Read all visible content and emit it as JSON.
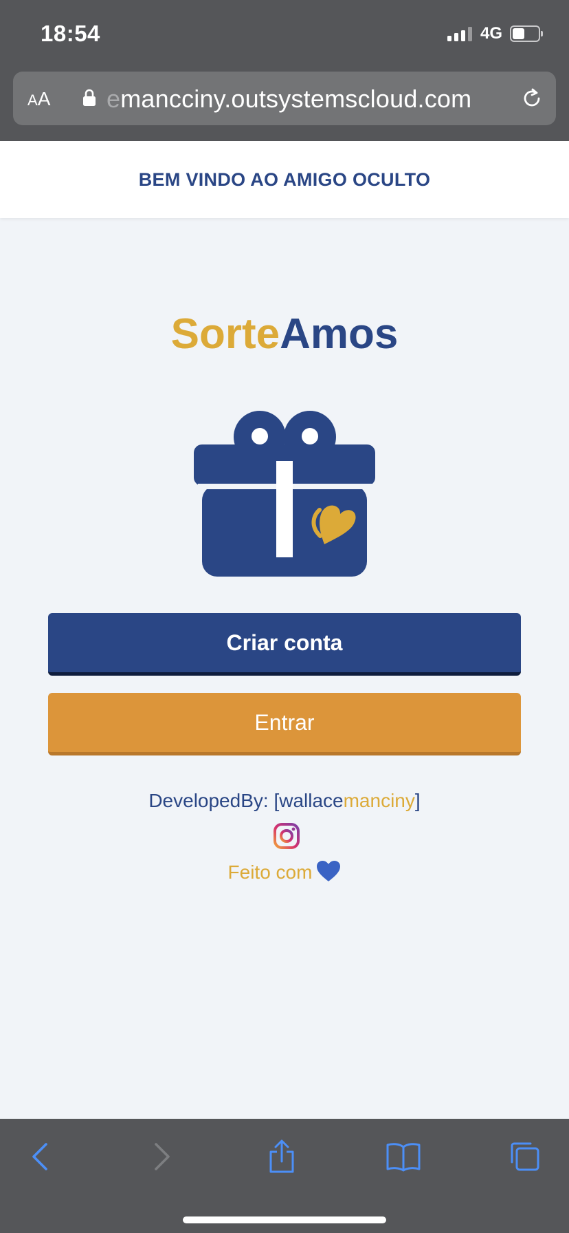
{
  "status_bar": {
    "time": "18:54",
    "network": "4G",
    "battery_level": 0.5
  },
  "browser": {
    "text_size_label_small": "A",
    "text_size_label_large": "A",
    "url_faded": "e",
    "url_main": "mancciny.outsystemscloud.com"
  },
  "header": {
    "title": "BEM VINDO AO AMIGO OCULTO"
  },
  "brand": {
    "part1": "Sorte",
    "part2": "Amos"
  },
  "buttons": {
    "create_account": "Criar conta",
    "login": "Entrar"
  },
  "footer": {
    "developed_by_prefix": "DevelopedBy: [wallace",
    "developed_by_highlight": "manciny",
    "developed_by_suffix": "]",
    "made_with": "Feito com"
  },
  "icons": {
    "gift": "gift-heart-logo",
    "instagram": "instagram-icon",
    "heart": "heart-icon"
  },
  "colors": {
    "primary_blue": "#2a4685",
    "gold": "#dcaa38",
    "orange_button": "#dc953a",
    "page_background": "#f1f4f8",
    "browser_chrome": "#555659",
    "browser_accent": "#4c8ff7"
  }
}
